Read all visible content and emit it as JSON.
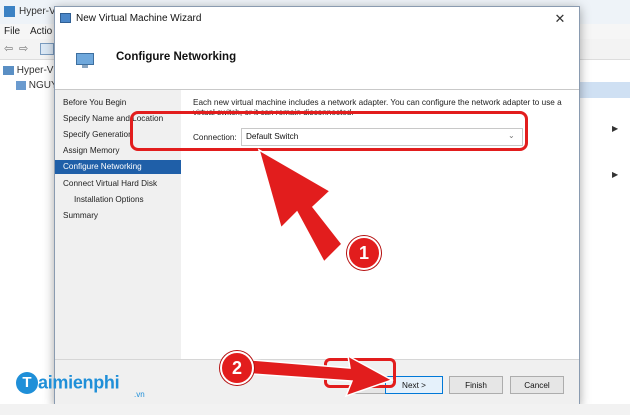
{
  "background_app": {
    "title": "Hyper-V",
    "menu": [
      "File",
      "Actio"
    ],
    "tree": [
      "Hyper-V",
      "NGUY"
    ]
  },
  "dialog": {
    "title": "New Virtual Machine Wizard",
    "close_label": "✕",
    "header_title": "Configure Networking",
    "nav": [
      {
        "label": "Before You Begin",
        "active": false,
        "indent": false
      },
      {
        "label": "Specify Name and Location",
        "active": false,
        "indent": false
      },
      {
        "label": "Specify Generation",
        "active": false,
        "indent": false
      },
      {
        "label": "Assign Memory",
        "active": false,
        "indent": false
      },
      {
        "label": "Configure Networking",
        "active": true,
        "indent": false
      },
      {
        "label": "Connect Virtual Hard Disk",
        "active": false,
        "indent": false
      },
      {
        "label": "Installation Options",
        "active": false,
        "indent": true
      },
      {
        "label": "Summary",
        "active": false,
        "indent": false
      }
    ],
    "description": "Each new virtual machine includes a network adapter. You can configure the network adapter to use a virtual switch, or it can remain disconnected.",
    "connection_label": "Connection:",
    "connection_value": "Default Switch",
    "buttons": {
      "next": "Next >",
      "finish": "Finish",
      "cancel": "Cancel"
    }
  },
  "annotations": {
    "badge_1": "1",
    "badge_2": "2",
    "highlight_color": "#e21d1d"
  },
  "watermark": {
    "logo_letter": "T",
    "brand": "aimienphi",
    "suffix": ".vn"
  }
}
